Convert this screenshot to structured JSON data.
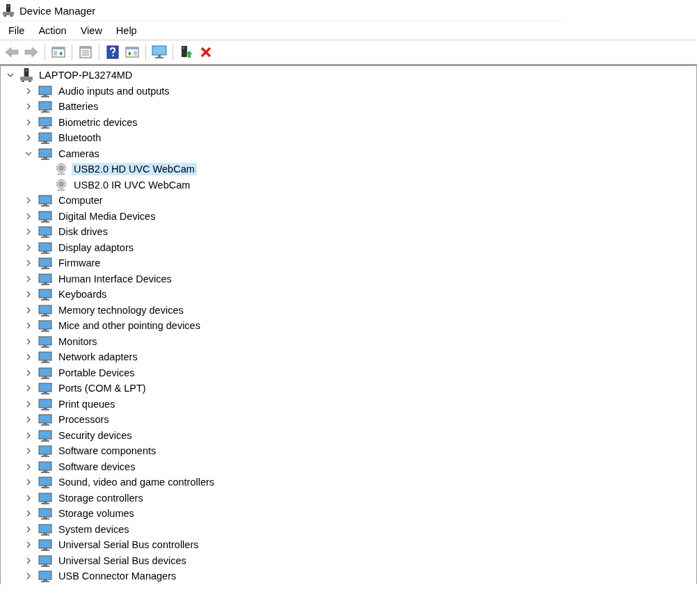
{
  "window": {
    "title": "Device Manager"
  },
  "menu": [
    "File",
    "Action",
    "View",
    "Help"
  ],
  "toolbar": [
    {
      "kind": "back",
      "disabled": true
    },
    {
      "kind": "forward",
      "disabled": true
    },
    {
      "kind": "sep"
    },
    {
      "kind": "tree",
      "disabled": false
    },
    {
      "kind": "sep"
    },
    {
      "kind": "props",
      "disabled": false
    },
    {
      "kind": "sep"
    },
    {
      "kind": "help",
      "disabled": false
    },
    {
      "kind": "pane",
      "disabled": false
    },
    {
      "kind": "sep"
    },
    {
      "kind": "scan",
      "disabled": false
    },
    {
      "kind": "sep"
    },
    {
      "kind": "update",
      "disabled": false
    },
    {
      "kind": "uninstall",
      "disabled": false
    }
  ],
  "tree": {
    "label": "LAPTOP-PL3274MD",
    "expanded": true,
    "children": [
      {
        "label": "Audio inputs and outputs",
        "expanded": false
      },
      {
        "label": "Batteries",
        "expanded": false
      },
      {
        "label": "Biometric devices",
        "expanded": false
      },
      {
        "label": "Bluetooth",
        "expanded": false
      },
      {
        "label": "Cameras",
        "expanded": true,
        "children": [
          {
            "label": "USB2.0 HD UVC WebCam",
            "selected": true
          },
          {
            "label": "USB2.0 IR UVC WebCam",
            "selected": false
          }
        ]
      },
      {
        "label": "Computer",
        "expanded": false
      },
      {
        "label": "Digital Media Devices",
        "expanded": false
      },
      {
        "label": "Disk drives",
        "expanded": false
      },
      {
        "label": "Display adaptors",
        "expanded": false
      },
      {
        "label": "Firmware",
        "expanded": false
      },
      {
        "label": "Human Interface Devices",
        "expanded": false
      },
      {
        "label": "Keyboards",
        "expanded": false
      },
      {
        "label": "Memory technology devices",
        "expanded": false
      },
      {
        "label": "Mice and other pointing devices",
        "expanded": false
      },
      {
        "label": "Monitors",
        "expanded": false
      },
      {
        "label": "Network adapters",
        "expanded": false
      },
      {
        "label": "Portable Devices",
        "expanded": false
      },
      {
        "label": "Ports (COM & LPT)",
        "expanded": false
      },
      {
        "label": "Print queues",
        "expanded": false
      },
      {
        "label": "Processors",
        "expanded": false
      },
      {
        "label": "Security devices",
        "expanded": false
      },
      {
        "label": "Software components",
        "expanded": false
      },
      {
        "label": "Software devices",
        "expanded": false
      },
      {
        "label": "Sound, video and game controllers",
        "expanded": false
      },
      {
        "label": "Storage controllers",
        "expanded": false
      },
      {
        "label": "Storage volumes",
        "expanded": false
      },
      {
        "label": "System devices",
        "expanded": false
      },
      {
        "label": "Universal Serial Bus controllers",
        "expanded": false
      },
      {
        "label": "Universal Serial Bus devices",
        "expanded": false
      },
      {
        "label": "USB Connector Managers",
        "expanded": false
      }
    ]
  }
}
